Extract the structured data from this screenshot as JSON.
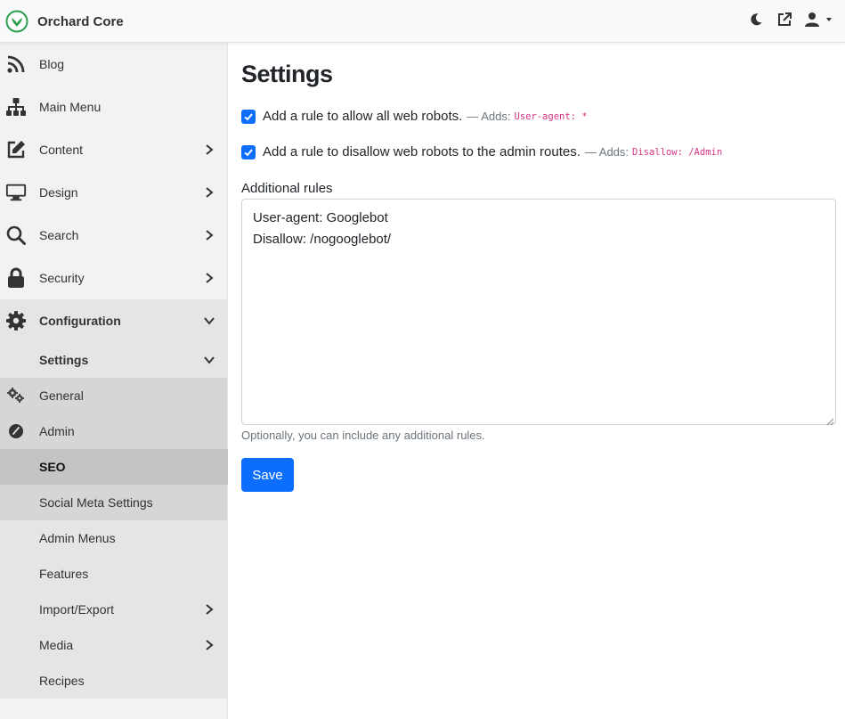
{
  "app": {
    "title": "Orchard Core",
    "icons": [
      "orchard-logo-icon",
      "moon-icon",
      "external-link-icon",
      "user-icon",
      "caret-down-icon"
    ],
    "colors": {
      "accent": "#0d6efd",
      "logo_green": "#2e9e4f",
      "code": "#d63384"
    }
  },
  "sidebar": {
    "items": [
      {
        "label": "Blog",
        "icon": "rss-icon"
      },
      {
        "label": "Main Menu",
        "icon": "sitemap-icon"
      },
      {
        "label": "Content",
        "icon": "edit-icon"
      },
      {
        "label": "Design",
        "icon": "monitor-icon"
      },
      {
        "label": "Search",
        "icon": "search-icon"
      },
      {
        "label": "Security",
        "icon": "lock-icon"
      },
      {
        "label": "Configuration",
        "icon": "gear-icon"
      }
    ],
    "submenu": {
      "settings": "Settings",
      "general": "General",
      "admin": "Admin",
      "seo": "SEO",
      "social_meta": "Social Meta Settings",
      "admin_menus": "Admin Menus",
      "features": "Features",
      "import_export": "Import/Export",
      "media": "Media",
      "recipes": "Recipes"
    }
  },
  "main": {
    "title": "Settings",
    "allow_rule": {
      "label": "Add a rule to allow all web robots.",
      "adds": "— Adds:",
      "code": "User-agent: *",
      "checked": true
    },
    "disallow_rule": {
      "label": "Add a rule to disallow web robots to the admin routes.",
      "adds": "— Adds:",
      "code": "Disallow: /Admin",
      "checked": true
    },
    "additional_rules": {
      "label": "Additional rules",
      "value": "User-agent: Googlebot\nDisallow: /nogooglebot/",
      "help": "Optionally, you can include any additional rules."
    },
    "save_label": "Save"
  }
}
